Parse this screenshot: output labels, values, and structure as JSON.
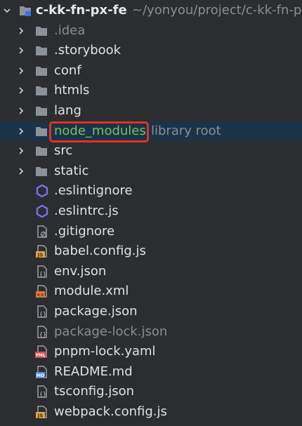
{
  "root": {
    "name": "c-kk-fn-px-fe",
    "path": "~/yonyou/project/c-kk-fn-p"
  },
  "folders": [
    {
      "label": ".idea",
      "muted": true
    },
    {
      "label": ".storybook",
      "muted": false
    },
    {
      "label": "conf",
      "muted": false
    },
    {
      "label": "htmls",
      "muted": false
    },
    {
      "label": "lang",
      "muted": false
    },
    {
      "label": "node_modules",
      "suffix": "library root",
      "selected": true
    },
    {
      "label": "src",
      "muted": false
    },
    {
      "label": "static",
      "muted": false
    }
  ],
  "files": [
    {
      "label": ".eslintignore",
      "icon": "eslint-icon"
    },
    {
      "label": ".eslintrc.js",
      "icon": "eslint-icon"
    },
    {
      "label": ".gitignore",
      "icon": "ignore-file-icon"
    },
    {
      "label": "babel.config.js",
      "icon": "js-file-icon",
      "badge": "JS"
    },
    {
      "label": "env.json",
      "icon": "json-file-icon"
    },
    {
      "label": "module.xml",
      "icon": "xml-file-icon",
      "badge": "<>"
    },
    {
      "label": "package.json",
      "icon": "json-file-icon"
    },
    {
      "label": "package-lock.json",
      "icon": "json-file-icon",
      "muted": true
    },
    {
      "label": "pnpm-lock.yaml",
      "icon": "yaml-file-icon",
      "badge": "YML"
    },
    {
      "label": "README.md",
      "icon": "markdown-file-icon",
      "badge": "MD"
    },
    {
      "label": "tsconfig.json",
      "icon": "json-file-icon"
    },
    {
      "label": "webpack.config.js",
      "icon": "js-file-icon",
      "badge": "JS"
    }
  ],
  "colors": {
    "background": "#2b2d30",
    "selection": "#1a3348",
    "highlight_border": "#e5311e",
    "excluded_text": "#7dbf5a",
    "folder": "#8c9299"
  }
}
